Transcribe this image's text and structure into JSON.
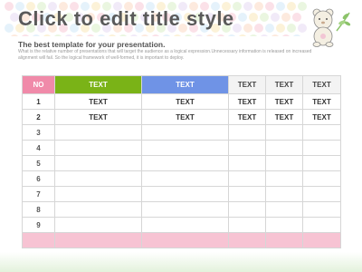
{
  "slide": {
    "title": "Click to edit title style",
    "subtitle": "The best template for your presentation.",
    "description": "What is the relative number of presentations that will target the audience as a logical expression.Unnecessary information is released on increased alignment will fail. So the logical framework of well-formed, it is important to deploy."
  },
  "table": {
    "headers": [
      "NO",
      "TEXT",
      "TEXT",
      "TEXT",
      "TEXT",
      "TEXT"
    ],
    "rows": [
      [
        "1",
        "TEXT",
        "TEXT",
        "TEXT",
        "TEXT",
        "TEXT"
      ],
      [
        "2",
        "TEXT",
        "TEXT",
        "TEXT",
        "TEXT",
        "TEXT"
      ],
      [
        "3",
        "",
        "",
        "",
        "",
        ""
      ],
      [
        "4",
        "",
        "",
        "",
        "",
        ""
      ],
      [
        "5",
        "",
        "",
        "",
        "",
        ""
      ],
      [
        "6",
        "",
        "",
        "",
        "",
        ""
      ],
      [
        "7",
        "",
        "",
        "",
        "",
        ""
      ],
      [
        "8",
        "",
        "",
        "",
        "",
        ""
      ],
      [
        "9",
        "",
        "",
        "",
        "",
        ""
      ],
      [
        "",
        "",
        "",
        "",
        "",
        ""
      ]
    ]
  },
  "colors": {
    "no_header": "#f08aa9",
    "green_header": "#7ab317",
    "blue_header": "#6f93e6",
    "footer_row": "#f7c3d3"
  },
  "decoration": {
    "icon": "bear-with-leaf-icon",
    "pattern": "pastel-dots"
  }
}
